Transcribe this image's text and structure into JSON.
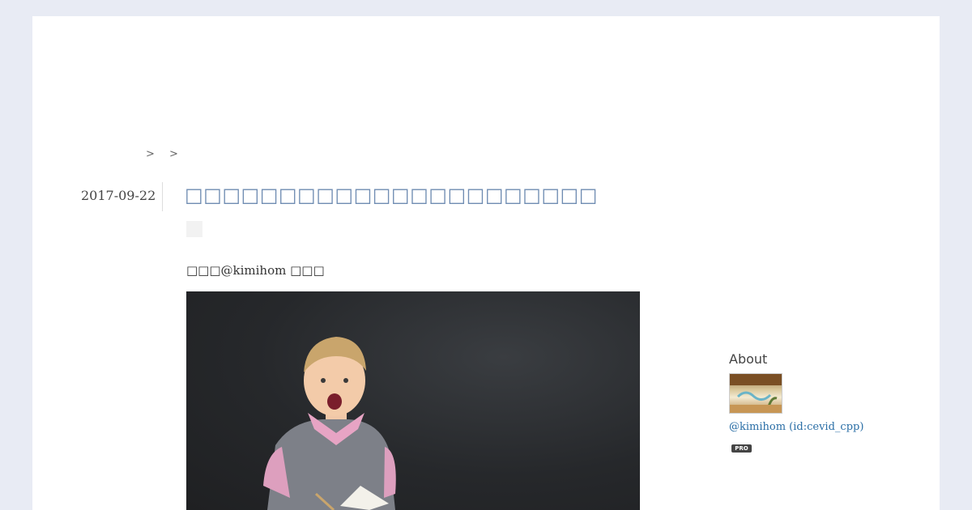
{
  "breadcrumb": {
    "sep1": ">",
    "sep2": ">"
  },
  "entry": {
    "date": "2017-09-22",
    "title": "□□□□□□□□□□□□□□□□□□□□□□",
    "lead_text": "□□□@kimihom □□□"
  },
  "sidebar": {
    "about_title": "About",
    "profile_link": "@kimihom (id:cevid_cpp)",
    "pro_badge": "PRO"
  }
}
